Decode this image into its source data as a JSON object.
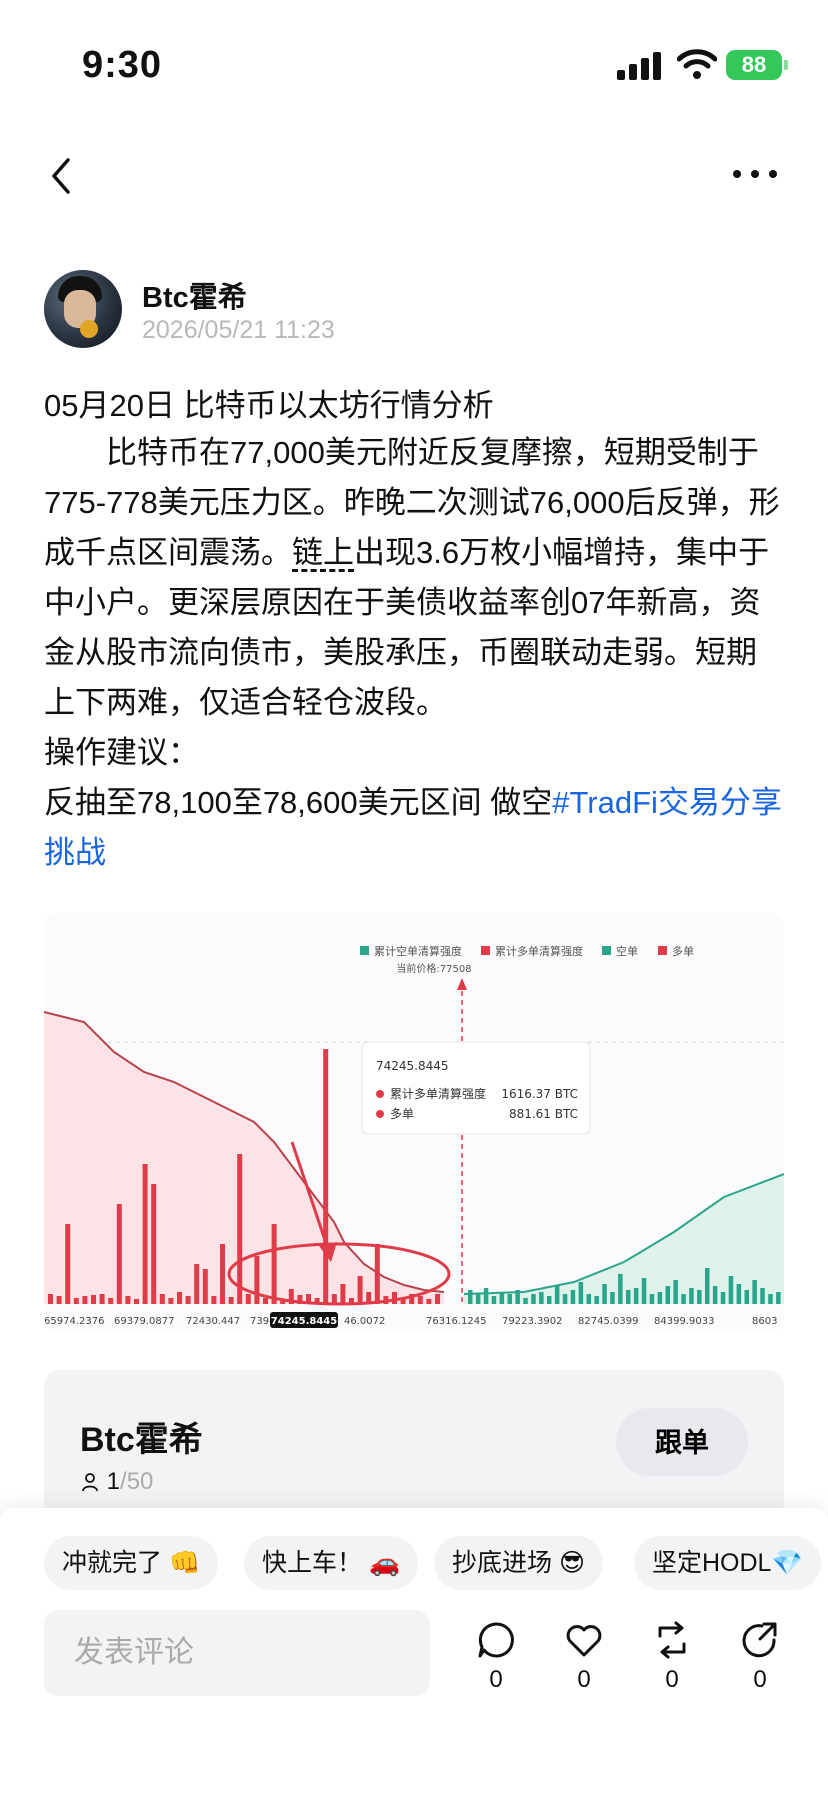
{
  "status_bar": {
    "time": "9:30",
    "battery": "88"
  },
  "author": {
    "name": "Btc霍希",
    "date": "2026/05/21 11:23"
  },
  "post": {
    "title": "05月20日  比特币以太坊行情分析",
    "p1_part1": "比特币在77,000美元附近反复摩擦，短期受制于775-778美元压力区。昨晚二次测试76,000后反弹，形成千点区间震荡。",
    "p1_chain": "链上",
    "p1_part2": "出现3.6万枚小幅增持，集中于中小户。更深层原因在于美债收益率创07年新高，资金从股市流向债市，美股承压，币圈联动走弱。短期上下两难，仅适合轻仓波段。",
    "p2": "操作建议：",
    "p3": "反抽至78,100至78,600美元区间   做空",
    "hashtag": "#TradFi交易分享挑战"
  },
  "chart": {
    "legend": [
      "累计空单清算强度",
      "累计多单清算强度",
      "空单",
      "多单"
    ],
    "current_price": "当前价格:77508",
    "tooltip_price": "74245.8445",
    "tooltip_rows": [
      {
        "label": "累计多单清算强度",
        "value": "1616.37 BTC"
      },
      {
        "label": "多单",
        "value": "881.61 BTC"
      }
    ],
    "x_ticks": [
      "65974.2376",
      "69379.0877",
      "72430.447",
      "7394",
      "74245.8445",
      "46.0072",
      "76316.1245",
      "79223.3902",
      "82745.0399",
      "84399.9033",
      "8603"
    ],
    "colors": {
      "short": "#2aa58a",
      "long": "#e03b48"
    }
  },
  "chart_data": {
    "type": "bar",
    "title": "",
    "series": [
      {
        "name": "累计空单清算强度",
        "type": "area"
      },
      {
        "name": "累计多单清算强度",
        "type": "area"
      },
      {
        "name": "空单",
        "type": "bar"
      },
      {
        "name": "多单",
        "type": "bar"
      }
    ],
    "highlight": {
      "price": 74245.8445,
      "累计多单清算强度_BTC": 1616.37,
      "多单_BTC": 881.61
    },
    "current_price": 77508
  },
  "profile_card": {
    "name": "Btc霍希",
    "count": "1",
    "count_total": "/50",
    "follow_label": "跟单"
  },
  "chips": [
    "冲就完了 👊",
    "快上车！ 🚗",
    "抄底进场 😎",
    "坚定HODL💎"
  ],
  "comment_placeholder": "发表评论",
  "actions": [
    {
      "icon": "comment-icon",
      "count": "0"
    },
    {
      "icon": "like-icon",
      "count": "0"
    },
    {
      "icon": "repost-icon",
      "count": "0"
    },
    {
      "icon": "share-icon",
      "count": "0"
    }
  ]
}
